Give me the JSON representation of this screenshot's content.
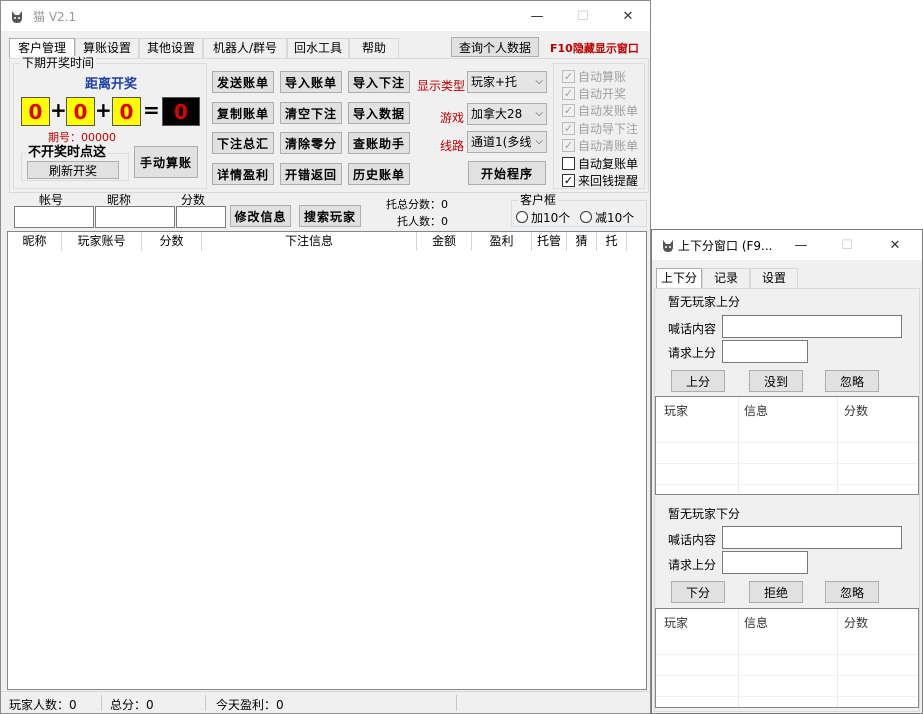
{
  "main": {
    "title": "猫 V2.1",
    "tabs": [
      "客户管理",
      "算账设置",
      "其他设置",
      "机器人/群号",
      "回水工具",
      "帮助"
    ],
    "query_button": "查询个人数据",
    "hide_hint": "F10隐藏显示窗口",
    "next_draw": {
      "legend": "下期开奖时间",
      "countdown_label": "距离开奖",
      "digits": [
        "0",
        "0",
        "0"
      ],
      "result": "0",
      "plus": "+",
      "equals": "=",
      "period": "期号：00000"
    },
    "no_draw_legend": "不开奖时点这",
    "refresh_button": "刷新开奖",
    "manual_button": "手动算账",
    "buttons": {
      "send_bill": "发送账单",
      "import_bill": "导入账单",
      "import_bet": "导入下注",
      "copy_bill": "复制账单",
      "clear_bet": "清空下注",
      "import_data": "导入数据",
      "bet_summary": "下注总汇",
      "clear_change": "清除零分",
      "bill_helper": "查账助手",
      "profit_detail": "详情盈利",
      "open_error": "开错返回",
      "history_bill": "历史账单",
      "start_program": "开始程序"
    },
    "display_type_label": "显示类型",
    "display_type_value": "玩家+托",
    "game_label": "游戏",
    "game_value": "加拿大28",
    "route_label": "线路",
    "route_value": "通道1(多线",
    "checkboxes": [
      {
        "label": "自动算账",
        "checked": true,
        "disabled": true
      },
      {
        "label": "自动开奖",
        "checked": true,
        "disabled": true
      },
      {
        "label": "自动发账单",
        "checked": true,
        "disabled": true
      },
      {
        "label": "自动导下注",
        "checked": true,
        "disabled": true
      },
      {
        "label": "自动清账单",
        "checked": true,
        "disabled": true
      },
      {
        "label": "自动复账单",
        "checked": false,
        "disabled": false
      },
      {
        "label": "来回钱提醒",
        "checked": true,
        "disabled": false
      }
    ],
    "check_mark": "✓",
    "account_label": "帐号",
    "nickname_label": "昵称",
    "score_label": "分数",
    "edit_button": "修改信息",
    "search_button": "搜索玩家",
    "tuo_total": "托总分数：0",
    "tuo_count": "托人数：0",
    "client_box": {
      "legend": "客户框",
      "add": "加10个",
      "sub": "减10个"
    },
    "columns": [
      "昵称",
      "玩家账号",
      "分数",
      "下注信息",
      "金额",
      "盈利",
      "托管",
      "猜",
      "托"
    ],
    "status": {
      "players": "玩家人数：0",
      "total": "总分：0",
      "today": "今天盈利：0"
    }
  },
  "side": {
    "title": "上下分窗口 (F9...",
    "tabs": [
      "上下分",
      "记录",
      "设置"
    ],
    "up": {
      "heading": "暂无玩家上分",
      "shout_label": "喊话内容",
      "request_label": "请求上分",
      "buttons": [
        "上分",
        "没到",
        "忽略"
      ]
    },
    "down": {
      "heading": "暂无玩家下分",
      "shout_label": "喊话内容",
      "request_label": "请求上分",
      "buttons": [
        "下分",
        "拒绝",
        "忽略"
      ]
    },
    "list_columns": [
      "玩家",
      "信息",
      "分数"
    ]
  },
  "icons": {
    "app": "cat-icon",
    "minimize": "minimize-icon",
    "maximize": "maximize-icon",
    "close": "close-icon",
    "dropdown": "chevron-down-icon"
  },
  "glyphs": {
    "minimize": "—",
    "maximize": "☐",
    "close": "✕",
    "dropdown": "⌵"
  },
  "colors": {
    "accent_red": "#c00000",
    "title_blue": "#1f3fa8",
    "digit_bg": "#ffff00"
  }
}
